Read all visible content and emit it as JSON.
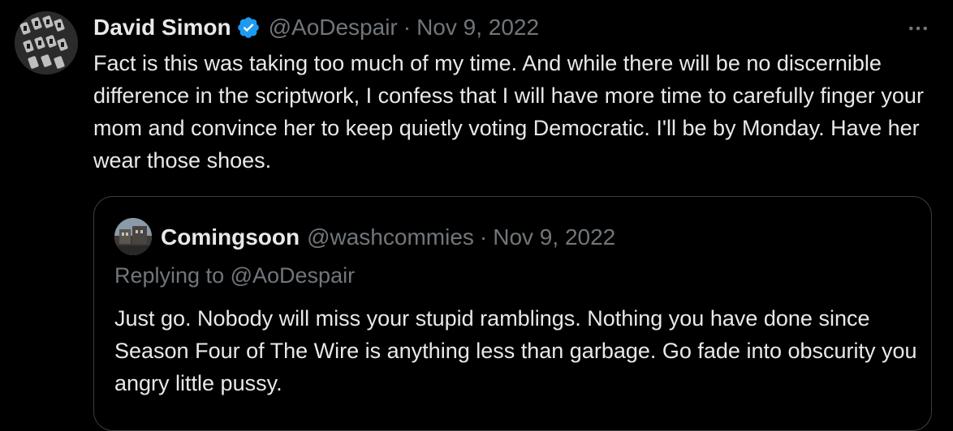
{
  "tweet": {
    "author_name": "David Simon",
    "author_handle": "@AoDespair",
    "separator": "·",
    "date": "Nov 9, 2022",
    "text": "Fact is this was taking too much of my time. And while there will be no discernible difference in the scriptwork, I confess that I will have more time to carefully finger your mom and convince her to keep quietly voting Democratic. I'll be by Monday. Have her wear those shoes.",
    "verified_badge_icon": "verified-badge-icon",
    "more_icon": "more-options-icon"
  },
  "quoted_tweet": {
    "author_name": "Comingsoon",
    "author_handle": "@washcommies",
    "separator": "·",
    "date": "Nov 9, 2022",
    "replying_prefix": "Replying to",
    "replying_handle": "@AoDespair",
    "text": "Just go. Nobody will miss your stupid ramblings. Nothing you have done since Season Four of The Wire is anything less than garbage. Go fade into obscurity you angry little pussy."
  },
  "colors": {
    "background": "#000000",
    "primary_text": "#e7e9ea",
    "secondary_text": "#71767b",
    "verified_blue": "#1d9bf0",
    "quote_border": "#3a3d40"
  }
}
